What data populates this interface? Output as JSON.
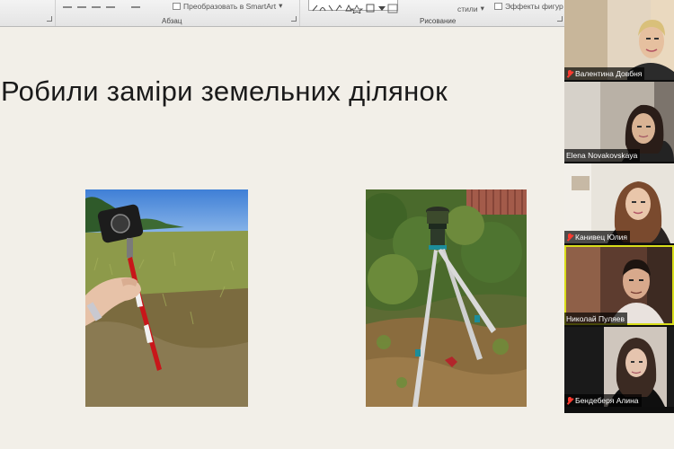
{
  "ribbon": {
    "abzac_label": "Абзац",
    "smartart_label": "Преобразовать в SmartArt",
    "styles_label": "стили",
    "effects_label": "Эффекты фигур",
    "drawing_label": "Рисование"
  },
  "slide": {
    "title": "Робили заміри земельних ділянок"
  },
  "participants": [
    {
      "name": "Валентина Довбня",
      "muted": true
    },
    {
      "name": "Elena Novakovskaya",
      "muted": false
    },
    {
      "name": "Канивец Юлия",
      "muted": true
    },
    {
      "name": "Николай Пуляев",
      "muted": false,
      "active": true
    },
    {
      "name": "Бендеберя Алина",
      "muted": true
    }
  ],
  "colors": {
    "active_speaker": "#d8dd1a",
    "muted_icon": "#ff3b30",
    "slide_bg": "#f2efe8"
  },
  "icons": {
    "smartart": "smartart-icon",
    "effects": "shape-effects-icon",
    "muted": "mic-muted-icon"
  }
}
